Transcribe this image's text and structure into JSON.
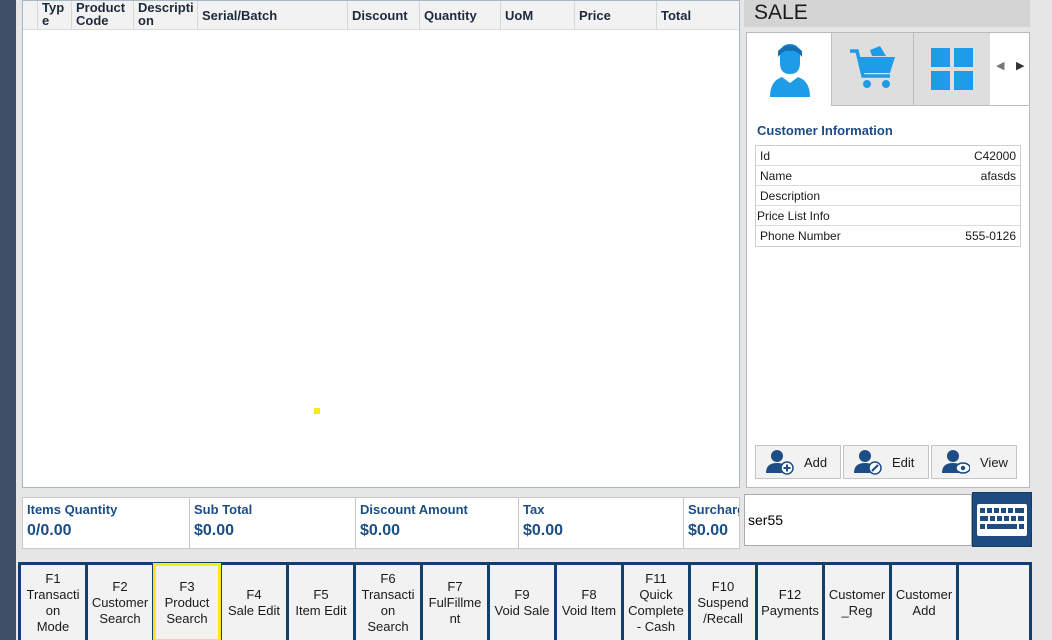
{
  "grid": {
    "columns": [
      "Typ\ne",
      "Product\nCode",
      "Descripti\non",
      "Serial/Batch",
      "Discount",
      "Quantity",
      "UoM",
      "Price",
      "Total"
    ]
  },
  "side": {
    "title": "SALE",
    "tabs": [
      {
        "icon": "customer-icon"
      },
      {
        "icon": "shopping-cart-icon"
      },
      {
        "icon": "grid-icon"
      }
    ],
    "customer_info": {
      "title": "Customer Information",
      "rows": [
        {
          "key": "Id",
          "value": "C42000"
        },
        {
          "key": "Name",
          "value": "afasds"
        },
        {
          "key": "Description",
          "value": ""
        },
        {
          "key": "Price List Info",
          "value": ""
        },
        {
          "key": "Phone Number",
          "value": "555-0126"
        }
      ]
    },
    "actions": [
      {
        "label": "Add",
        "icon": "add-user-icon"
      },
      {
        "label": "Edit",
        "icon": "edit-user-icon"
      },
      {
        "label": "View",
        "icon": "view-user-icon"
      }
    ]
  },
  "totals": [
    {
      "label": "Items Quantity",
      "value": "0/0.00"
    },
    {
      "label": "Sub Total",
      "value": "$0.00"
    },
    {
      "label": "Discount Amount",
      "value": "$0.00"
    },
    {
      "label": "Tax",
      "value": "$0.00"
    },
    {
      "label": "Surcharge",
      "value": "$0.00"
    }
  ],
  "scan_input": {
    "value": "ser55"
  },
  "function_keys": [
    {
      "label": "F1\nTransacti\non\nMode"
    },
    {
      "label": "F2\nCustomer\nSearch"
    },
    {
      "label": "F3\nProduct\nSearch"
    },
    {
      "label": "F4\nSale Edit"
    },
    {
      "label": "F5\nItem Edit"
    },
    {
      "label": "F6\nTransacti\non\nSearch"
    },
    {
      "label": "F7\nFulFillme\nnt"
    },
    {
      "label": "F9\nVoid Sale"
    },
    {
      "label": "F8\nVoid Item"
    },
    {
      "label": "F11\nQuick\nComplete\n- Cash"
    },
    {
      "label": "F10\nSuspend\n/Recall"
    },
    {
      "label": "F12\nPayments"
    },
    {
      "label": "Customer\n_Reg"
    },
    {
      "label": "Customer\nAdd"
    },
    {
      "label": ""
    }
  ],
  "colors": {
    "accent": "#1c4d85",
    "key_bar": "#12406e",
    "highlight": "#f7ec16",
    "icon_blue": "#1e9ce8"
  }
}
